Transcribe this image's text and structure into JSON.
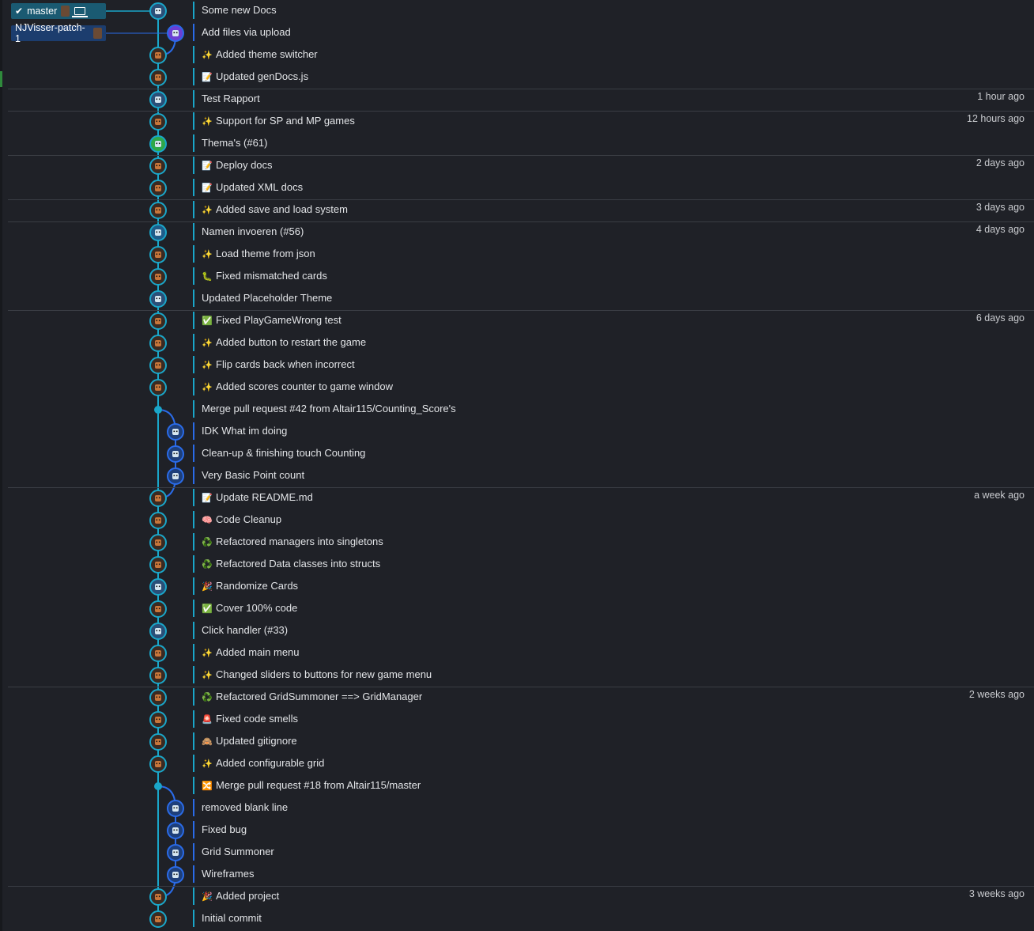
{
  "colors": {
    "background": "#1f2127",
    "lane_main": "#1aa6c9",
    "lane_branch": "#2a6be8",
    "master_tag_bg": "#1a5a72",
    "patch_tag_bg": "#1c3d6e"
  },
  "branches": {
    "master": {
      "label": "master",
      "check_icon": "check-icon",
      "device_icon": "laptop-icon"
    },
    "patch": {
      "label": "NJVisser-patch-1"
    }
  },
  "commits": [
    {
      "message": "Some new Docs",
      "emoji": "",
      "time": "",
      "lane": 0,
      "avatar": "robot",
      "tag": "master"
    },
    {
      "message": "Add files via upload",
      "emoji": "",
      "time": "",
      "lane": 1,
      "avatar": "invader",
      "tag": "patch"
    },
    {
      "message": "Added theme switcher",
      "emoji": "✨",
      "time": "",
      "lane": 0,
      "avatar": "fox"
    },
    {
      "message": "Updated genDocs.js",
      "emoji": "📝",
      "time": "",
      "lane": 0,
      "avatar": "fox"
    },
    {
      "message": "Test Rapport",
      "emoji": "",
      "time": "1 hour ago",
      "lane": 0,
      "avatar": "robot"
    },
    {
      "message": "Support for SP and MP games",
      "emoji": "✨",
      "time": "12 hours ago",
      "lane": 0,
      "avatar": "fox"
    },
    {
      "message": "Thema's (#61)",
      "emoji": "",
      "time": "",
      "lane": 0,
      "avatar": "green"
    },
    {
      "message": "Deploy docs",
      "emoji": "📝",
      "time": "2 days ago",
      "lane": 0,
      "avatar": "fox"
    },
    {
      "message": "Updated XML docs",
      "emoji": "📝",
      "time": "",
      "lane": 0,
      "avatar": "fox"
    },
    {
      "message": "Added save and load system",
      "emoji": "✨",
      "time": "3 days ago",
      "lane": 0,
      "avatar": "fox"
    },
    {
      "message": "Namen invoeren (#56)",
      "emoji": "",
      "time": "4 days ago",
      "lane": 0,
      "avatar": "cross"
    },
    {
      "message": "Load theme from json",
      "emoji": "✨",
      "time": "",
      "lane": 0,
      "avatar": "fox"
    },
    {
      "message": "Fixed mismatched cards",
      "emoji": "🐛",
      "time": "",
      "lane": 0,
      "avatar": "fox"
    },
    {
      "message": "Updated Placeholder Theme",
      "emoji": "",
      "time": "",
      "lane": 0,
      "avatar": "robot"
    },
    {
      "message": "Fixed PlayGameWrong test",
      "emoji": "✅",
      "time": "6 days ago",
      "lane": 0,
      "avatar": "fox"
    },
    {
      "message": "Added button to restart the game",
      "emoji": "✨",
      "time": "",
      "lane": 0,
      "avatar": "fox"
    },
    {
      "message": "Flip cards back when incorrect",
      "emoji": "✨",
      "time": "",
      "lane": 0,
      "avatar": "fox"
    },
    {
      "message": "Added scores counter to game window",
      "emoji": "✨",
      "time": "",
      "lane": 0,
      "avatar": "fox"
    },
    {
      "message": "Merge pull request #42 from Altair115/Counting_Score's",
      "emoji": "",
      "time": "",
      "lane": 0,
      "avatar": "merge"
    },
    {
      "message": "IDK What im doing",
      "emoji": "",
      "time": "",
      "lane": 1,
      "avatar": "robot2"
    },
    {
      "message": "Clean-up & finishing touch Counting",
      "emoji": "",
      "time": "",
      "lane": 1,
      "avatar": "robot2"
    },
    {
      "message": "Very Basic Point count",
      "emoji": "",
      "time": "",
      "lane": 1,
      "avatar": "robot2"
    },
    {
      "message": "Update README.md",
      "emoji": "📝",
      "time": "a week ago",
      "lane": 0,
      "avatar": "fox"
    },
    {
      "message": "Code Cleanup",
      "emoji": "🧠",
      "time": "",
      "lane": 0,
      "avatar": "fox"
    },
    {
      "message": "Refactored managers into singletons",
      "emoji": "♻️",
      "time": "",
      "lane": 0,
      "avatar": "fox"
    },
    {
      "message": "Refactored Data classes into structs",
      "emoji": "♻️",
      "time": "",
      "lane": 0,
      "avatar": "fox"
    },
    {
      "message": "Randomize Cards",
      "emoji": "🎉",
      "time": "",
      "lane": 0,
      "avatar": "robot"
    },
    {
      "message": "Cover 100% code",
      "emoji": "✅",
      "time": "",
      "lane": 0,
      "avatar": "fox"
    },
    {
      "message": "Click handler (#33)",
      "emoji": "",
      "time": "",
      "lane": 0,
      "avatar": "robot"
    },
    {
      "message": "Added main menu",
      "emoji": "✨",
      "time": "",
      "lane": 0,
      "avatar": "fox"
    },
    {
      "message": "Changed sliders to buttons for new game menu",
      "emoji": "✨",
      "time": "",
      "lane": 0,
      "avatar": "fox"
    },
    {
      "message": "Refactored GridSummoner ==> GridManager",
      "emoji": "♻️",
      "time": "2 weeks ago",
      "lane": 0,
      "avatar": "fox"
    },
    {
      "message": "Fixed code smells",
      "emoji": "🚨",
      "time": "",
      "lane": 0,
      "avatar": "fox"
    },
    {
      "message": "Updated gitignore",
      "emoji": "🙈",
      "time": "",
      "lane": 0,
      "avatar": "fox"
    },
    {
      "message": "Added configurable grid",
      "emoji": "✨",
      "time": "",
      "lane": 0,
      "avatar": "fox"
    },
    {
      "message": "Merge pull request #18 from Altair115/master",
      "emoji": "🔀",
      "time": "",
      "lane": 0,
      "avatar": "merge"
    },
    {
      "message": "removed blank line",
      "emoji": "",
      "time": "",
      "lane": 1,
      "avatar": "robot2"
    },
    {
      "message": "Fixed bug",
      "emoji": "",
      "time": "",
      "lane": 1,
      "avatar": "robot2"
    },
    {
      "message": "Grid Summoner",
      "emoji": "",
      "time": "",
      "lane": 1,
      "avatar": "robot2"
    },
    {
      "message": "Wireframes",
      "emoji": "",
      "time": "",
      "lane": 1,
      "avatar": "robot2"
    },
    {
      "message": "Added project",
      "emoji": "🎉",
      "time": "3 weeks ago",
      "lane": 0,
      "avatar": "fox"
    },
    {
      "message": "Initial commit",
      "emoji": "",
      "time": "",
      "lane": 0,
      "avatar": "fox"
    }
  ]
}
